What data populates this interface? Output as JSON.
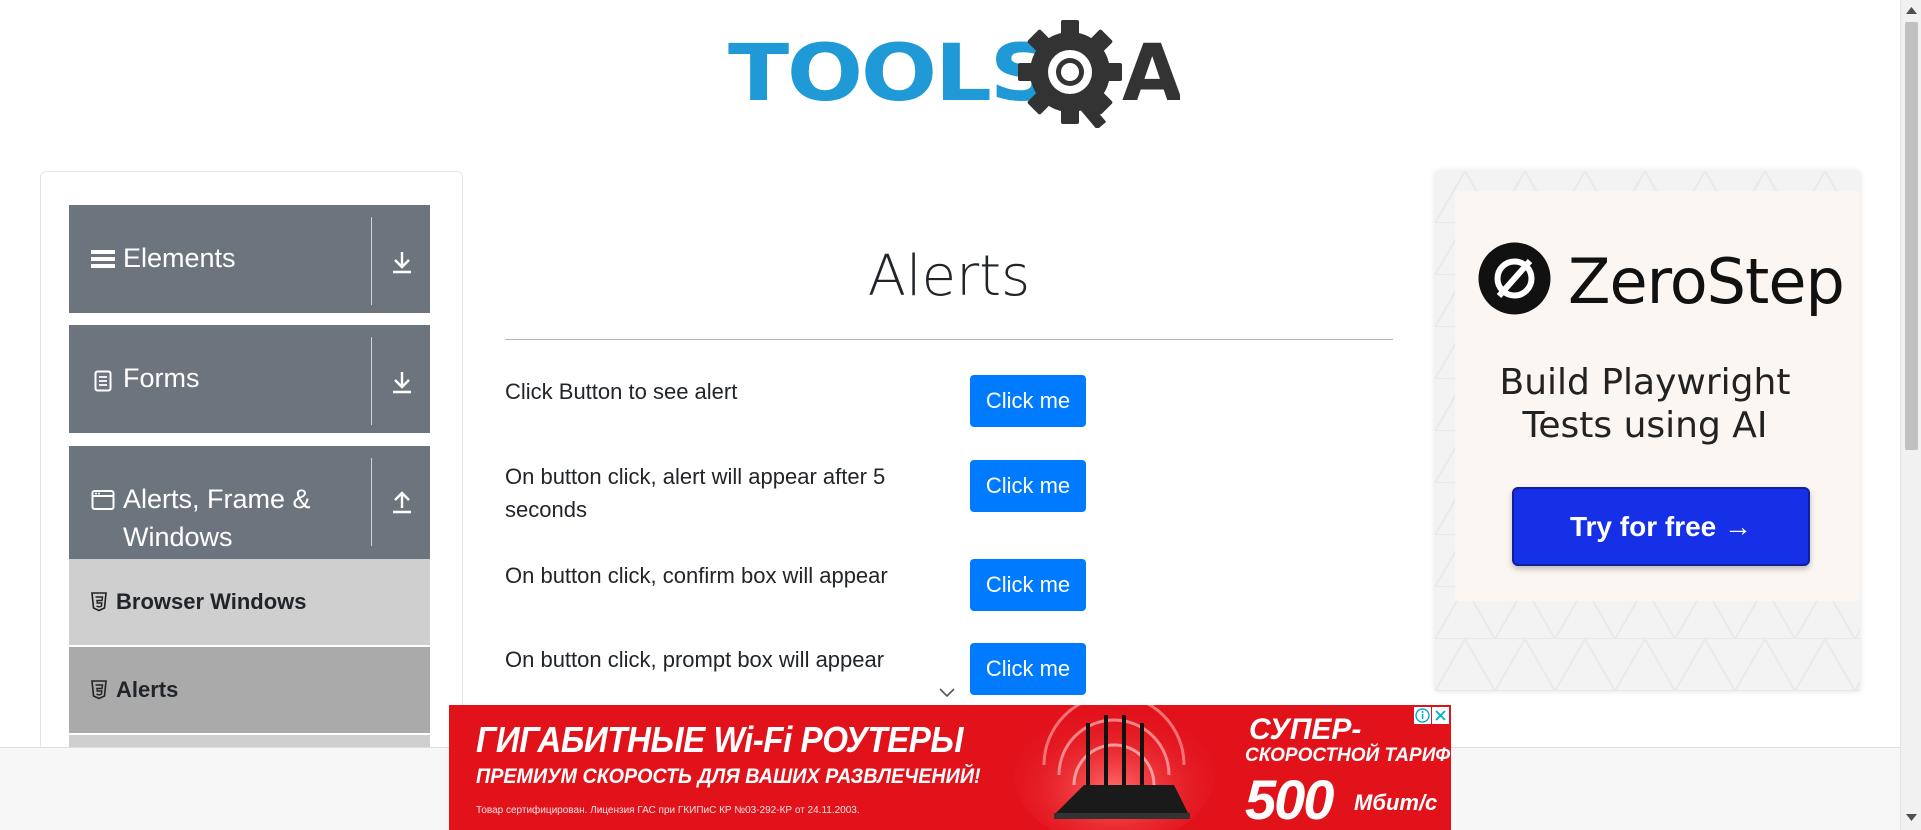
{
  "logo": {
    "text_tools": "TOOLS",
    "text_a": "A"
  },
  "sidebar": {
    "groups": [
      {
        "label": "Elements",
        "icon": "hamburger-icon",
        "arrow": "download-icon"
      },
      {
        "label": "Forms",
        "icon": "document-icon",
        "arrow": "download-icon"
      },
      {
        "label_line1": "Alerts, Frame &",
        "label_line2": "Windows",
        "icon": "window-icon",
        "arrow": "upload-icon"
      }
    ],
    "items": [
      {
        "label": "Browser Windows",
        "icon": "html5-icon"
      },
      {
        "label": "Alerts",
        "icon": "html5-icon",
        "active": true
      }
    ]
  },
  "main": {
    "title": "Alerts",
    "rows": [
      {
        "text": "Click Button to see alert",
        "button": "Click me"
      },
      {
        "text": "On button click, alert will appear after 5 seconds",
        "button": "Click me"
      },
      {
        "text": "On button click, confirm box will appear",
        "button": "Click me"
      },
      {
        "text": "On button click, prompt box will appear",
        "button": "Click me"
      }
    ]
  },
  "right_ad": {
    "brand": "ZeroStep",
    "tagline_line1": "Build Playwright",
    "tagline_line2": "Tests using AI",
    "cta": "Try for free →"
  },
  "bottom_ad": {
    "headline": "ГИГАБИТНЫЕ Wi-Fi РОУТЕРЫ",
    "subline": "ПРЕМИУМ СКОРОСТЬ ДЛЯ ВАШИХ РАЗВЛЕЧЕНИЙ!",
    "fine_print": "Товар сертифицирован. Лицензия ГАС при ГКИПиС КР №03-292-КР от 24.11.2003.",
    "super": "СУПЕР-",
    "tariff": "СКОРОСТНОЙ ТАРИФ",
    "speed": "500",
    "unit": "Мбит/с"
  },
  "colors": {
    "accent": "#007bff",
    "sidebar_group": "#6c757d",
    "sub_item": "#cfcfcf",
    "sub_item_active": "#aaaaaa",
    "logo_blue": "#1f9ad6",
    "ad_red": "#e2121b",
    "zerostep_cta": "#1530e6"
  }
}
